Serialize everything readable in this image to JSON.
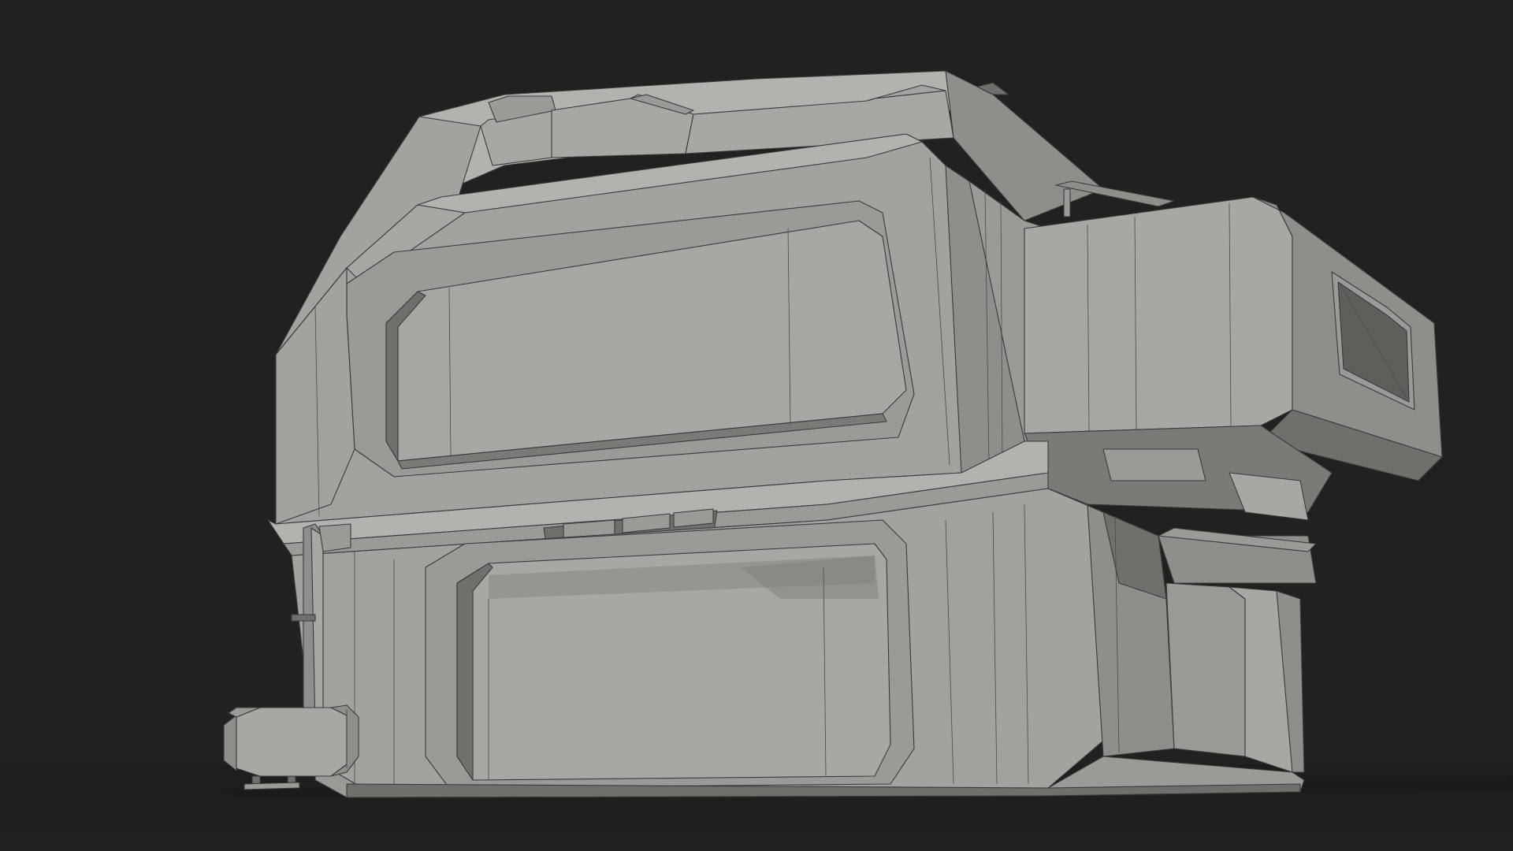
{
  "scene": {
    "subject": "sci-fi-container-building",
    "render_style": "clay-wireframe",
    "background_color": "#212121",
    "model_color": "#a3a39f",
    "wire_color": "#3a3a3a"
  }
}
